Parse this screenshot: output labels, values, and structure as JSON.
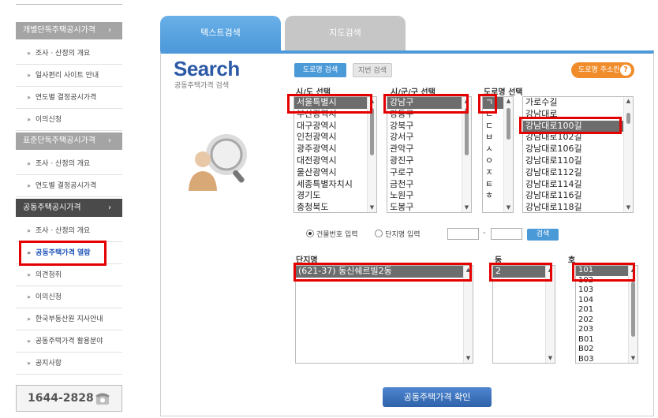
{
  "sidebar": {
    "sections": [
      {
        "label": "개별단독주택공시가격",
        "chevron": "›"
      },
      {
        "label": "표준단독주택공시가격",
        "chevron": "›"
      },
      {
        "label": "공동주택공시가격",
        "chevron": "›"
      }
    ],
    "group1": [
      "조사 · 산정의 개요",
      "일사편리 사이트 안내",
      "연도별 결정공시가격",
      "이의신청"
    ],
    "group2": [
      "조사 · 산정의 개요",
      "연도별 결정공시가격"
    ],
    "group3": [
      "조사 · 산정의 개요",
      "공동주택가격 열람",
      "의견청취",
      "이의신청",
      "한국부동산원 지사안내",
      "공동주택가격 활용분야",
      "공지사항"
    ],
    "bullet": "»",
    "phone": "1644-2828"
  },
  "tabs": {
    "text_search": "텍스트검색",
    "map_search": "지도검색"
  },
  "search": {
    "title": "Search",
    "subtitle": "공동주택가격 검색"
  },
  "buttons": {
    "road_search": "도로명 검색",
    "lot_search": "지번 검색",
    "road_address": "도로명 주소란",
    "go": "검색",
    "confirm": "공동주택가격 확인"
  },
  "columns": {
    "sido": "시/도 선택",
    "sigungu": "시/군/구 선택",
    "road": "도로명 선택",
    "complex": "단지명",
    "dong": "동",
    "ho": "호"
  },
  "lists": {
    "sido": [
      "서울특별시",
      "부산광역시",
      "대구광역시",
      "인천광역시",
      "광주광역시",
      "대전광역시",
      "울산광역시",
      "세종특별자치시",
      "경기도",
      "충청북도"
    ],
    "sigungu": [
      "강남구",
      "강동구",
      "강북구",
      "강서구",
      "관악구",
      "광진구",
      "구로구",
      "금천구",
      "노원구",
      "도봉구"
    ],
    "consonants": [
      "ㄱ",
      "ㄴ",
      "ㄷ",
      "ㅂ",
      "ㅅ",
      "ㅇ",
      "ㅈ",
      "ㅌ",
      "ㅎ"
    ],
    "roads": [
      "가로수길",
      "강남대로",
      "강남대로100길",
      "강남대로102길",
      "강남대로106길",
      "강남대로110길",
      "강남대로112길",
      "강남대로114길",
      "강남대로116길",
      "강남대로118길"
    ],
    "complex": [
      "(621-37) 동신쉐르빌2동"
    ],
    "dong": [
      "2"
    ],
    "ho": [
      "101",
      "102",
      "103",
      "104",
      "201",
      "202",
      "203",
      "B01",
      "B02",
      "B03"
    ]
  },
  "radio": {
    "building_no": "건물번호 입력",
    "complex_name": "단지명 입력"
  },
  "dash": "-"
}
